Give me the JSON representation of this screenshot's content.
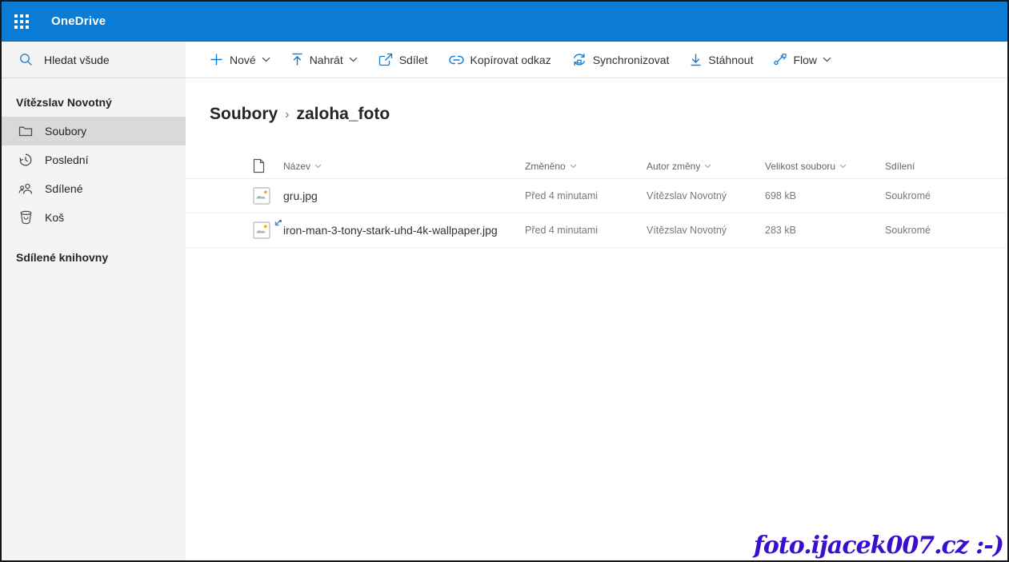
{
  "topbar": {
    "app_title": "OneDrive"
  },
  "sidebar": {
    "search_label": "Hledat všude",
    "user_section": "Vítězslav Novotný",
    "items": [
      {
        "label": "Soubory",
        "icon": "folder-icon",
        "selected": true
      },
      {
        "label": "Poslední",
        "icon": "history-icon",
        "selected": false
      },
      {
        "label": "Sdílené",
        "icon": "people-icon",
        "selected": false
      },
      {
        "label": "Koš",
        "icon": "trash-icon",
        "selected": false
      }
    ],
    "libraries_section": "Sdílené knihovny"
  },
  "toolbar": {
    "items": [
      {
        "label": "Nové",
        "icon": "plus-icon",
        "has_chevron": true
      },
      {
        "label": "Nahrát",
        "icon": "upload-icon",
        "has_chevron": true
      },
      {
        "label": "Sdílet",
        "icon": "share-icon",
        "has_chevron": false
      },
      {
        "label": "Kopírovat odkaz",
        "icon": "link-icon",
        "has_chevron": false
      },
      {
        "label": "Synchronizovat",
        "icon": "sync-icon",
        "has_chevron": false
      },
      {
        "label": "Stáhnout",
        "icon": "download-icon",
        "has_chevron": false
      },
      {
        "label": "Flow",
        "icon": "flow-icon",
        "has_chevron": true
      }
    ]
  },
  "breadcrumb": {
    "root": "Soubory",
    "separator": "›",
    "current": "zaloha_foto"
  },
  "table": {
    "headers": {
      "name": "Název",
      "modified": "Změněno",
      "modified_by": "Autor změny",
      "file_size": "Velikost souboru",
      "sharing": "Sdílení"
    },
    "rows": [
      {
        "name": "gru.jpg",
        "modified": "Před 4 minutami",
        "modified_by": "Vítězslav Novotný",
        "file_size": "698 kB",
        "sharing": "Soukromé",
        "type_icon": "image-file-icon"
      },
      {
        "name": "iron-man-3-tony-stark-uhd-4k-wallpaper.jpg",
        "modified": "Před 4 minutami",
        "modified_by": "Vítězslav Novotný",
        "file_size": "283 kB",
        "sharing": "Soukromé",
        "type_icon": "image-file-icon"
      }
    ]
  },
  "watermark": {
    "text": "foto.ijacek007.cz :-)"
  },
  "colors": {
    "topbar_blue": "#0a7cd6",
    "accent_blue": "#0f7bd7",
    "sidebar_bg": "#f4f4f4",
    "selected_item_bg": "#d9d9d9",
    "watermark_color": "#3a0dd2"
  }
}
